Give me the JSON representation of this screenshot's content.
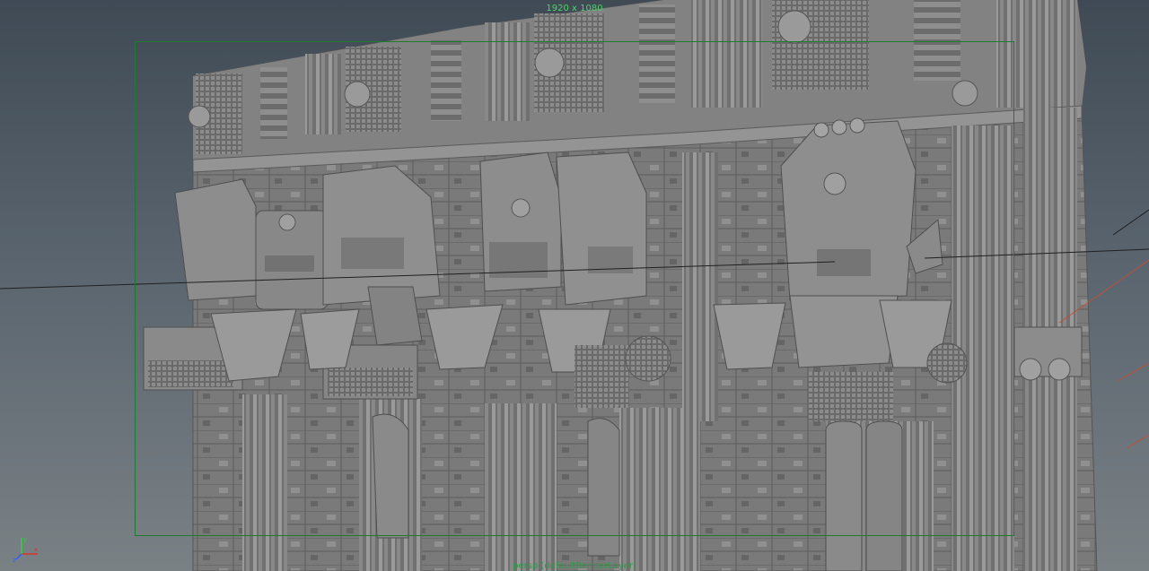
{
  "viewport": {
    "resolution_label": "1920 x 1080",
    "camera_label": "persp (defaultRenderLayer)"
  },
  "axis_gizmo": {
    "x_label": "x",
    "y_label": "y",
    "z_label": "z",
    "x_color": "#e03030",
    "y_color": "#30d040",
    "z_color": "#3060ff"
  },
  "colors": {
    "background_top": "#3f4a55",
    "background_bottom": "#7a8185",
    "gate_border": "#1e7a2e",
    "model_base": "#7c7c7c"
  }
}
